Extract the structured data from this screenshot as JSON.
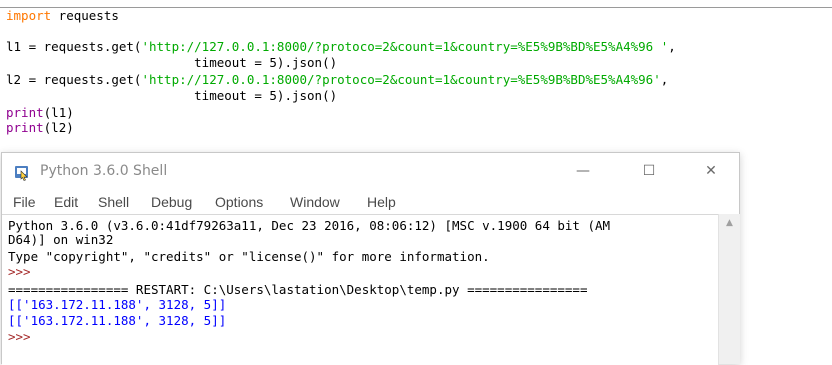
{
  "editor": {
    "lines": [
      {
        "kw": "import",
        "rest": " requests"
      },
      {
        "text": ""
      },
      {
        "pre": "l1 = requests.get(",
        "str": "'http://127.0.0.1:8000/?protoco=2&count=1&country=%E5%9B%BD%E5%A4%96 '",
        "post": ","
      },
      {
        "text": "                         timeout = 5).json()"
      },
      {
        "pre": "l2 = requests.get(",
        "str": "'http://127.0.0.1:8000/?protoco=2&count=1&country=%E5%9B%BD%E5%A4%96'",
        "post": ","
      },
      {
        "text": "                         timeout = 5).json()"
      },
      {
        "bi": "print",
        "rest": "(l1)"
      },
      {
        "bi": "print",
        "rest": "(l2)"
      }
    ]
  },
  "shell": {
    "title": "Python 3.6.0 Shell",
    "controls": {
      "minimize": "—",
      "maximize": "☐",
      "close": "✕"
    },
    "menu": [
      "File",
      "Edit",
      "Shell",
      "Debug",
      "Options",
      "Window",
      "Help"
    ],
    "lines": [
      {
        "cls": "",
        "text": "Python 3.6.0 (v3.6.0:41df79263a11, Dec 23 2016, 08:06:12) [MSC v.1900 64 bit (AM"
      },
      {
        "cls": "",
        "text": "D64)] on win32"
      },
      {
        "cls": "",
        "text": "Type \"copyright\", \"credits\" or \"license()\" for more information."
      },
      {
        "cls": "prompt",
        "text": ">>> "
      },
      {
        "cls": "",
        "text": "================ RESTART: C:\\Users\\lastation\\Desktop\\temp.py ================"
      },
      {
        "cls": "out",
        "text": "[['163.172.11.188', 3128, 5]]"
      },
      {
        "cls": "out",
        "text": "[['163.172.11.188', 3128, 5]]"
      },
      {
        "cls": "prompt",
        "text": ">>> "
      }
    ]
  }
}
